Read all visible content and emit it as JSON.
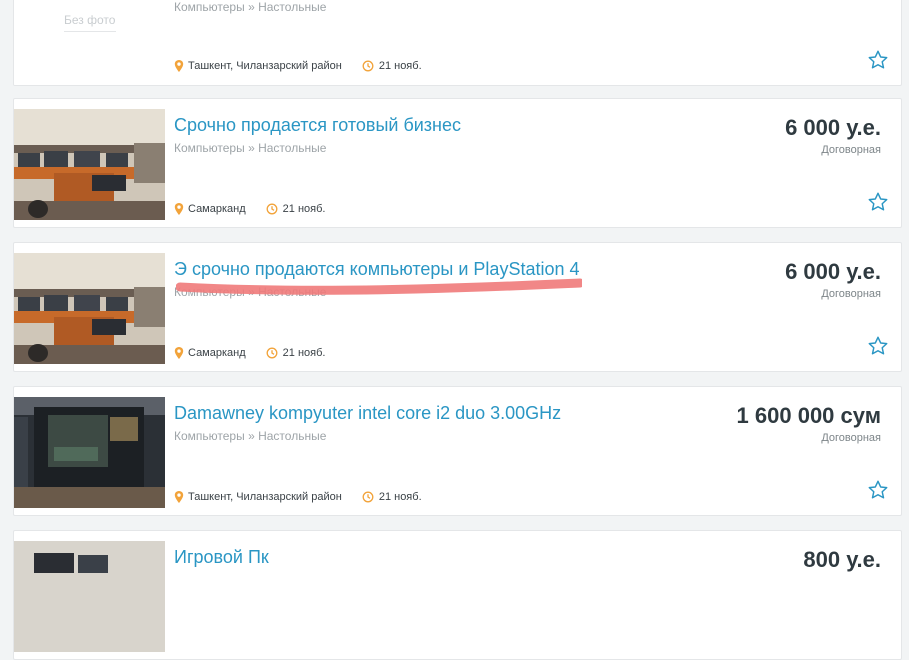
{
  "listings": [
    {
      "no_photo_label": "Без фото",
      "title": "",
      "category": "Компьютеры » Настольные",
      "price": "",
      "negotiable": "",
      "location": "Ташкент, Чиланзарский район",
      "date": "21 нояб."
    },
    {
      "title": "Срочно продается готовый бизнес",
      "category": "Компьютеры » Настольные",
      "price": "6 000 у.е.",
      "negotiable": "Договорная",
      "location": "Самарканд",
      "date": "21 нояб."
    },
    {
      "title": "Э срочно продаются компьютеры и PlayStation 4",
      "category": "Компьютеры » Настольные",
      "price": "6 000 у.е.",
      "negotiable": "Договорная",
      "location": "Самарканд",
      "date": "21 нояб."
    },
    {
      "title": "Damawney kompyuter intel core i2 duo 3.00GHz",
      "category": "Компьютеры » Настольные",
      "price": "1 600 000 сум",
      "negotiable": "Договорная",
      "location": "Ташкент, Чиланзарский район",
      "date": "21 нояб."
    },
    {
      "title": "Игровой Пк",
      "category": "",
      "price": "800 у.е.",
      "negotiable": "",
      "location": "",
      "date": ""
    }
  ],
  "colors": {
    "link": "#2a96c4",
    "accent_pin": "#f2a33a",
    "annotation_underline": "#f07a7a"
  },
  "icons": [
    "location-pin-icon",
    "clock-icon",
    "star-outline-icon"
  ]
}
